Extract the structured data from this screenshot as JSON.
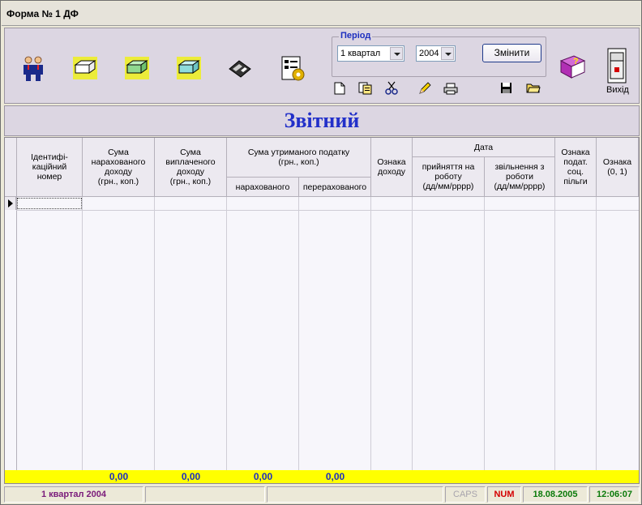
{
  "window": {
    "title": "Форма № 1 ДФ"
  },
  "toolbar": {
    "icons": [
      "people-icon",
      "tray-yellow-icon",
      "tray-green-icon",
      "tray-cyan-icon",
      "floppy-disk-icon",
      "settings-form-icon"
    ],
    "period": {
      "label": "Період",
      "quarter_value": "1 квартал",
      "year_value": "2004",
      "change_label": "Змінити"
    },
    "small_icons": [
      "new-document-icon",
      "copy-document-icon",
      "cut-icon",
      "edit-pencil-icon",
      "print-icon",
      "save-icon",
      "open-folder-icon"
    ],
    "help_icon": "help-book-icon",
    "exit_label": "Вихід"
  },
  "report": {
    "title": "Звітний"
  },
  "grid": {
    "headers": {
      "id": "Ідентифі-\nкаційний\nномер",
      "accrued_income": "Сума\nнарахованого\nдоходу\n(грн., коп.)",
      "paid_income": "Сума\nвиплаченого\nдоходу\n(грн., коп.)",
      "tax_withheld": "Сума утриманого податку\n(грн., коп.)",
      "tax_accrued": "нарахованого",
      "tax_transferred": "перерахованого",
      "income_sign": "Ознака\nдоходу",
      "date": "Дата",
      "hire_date": "прийняття на\nроботу\n(дд/мм/рррр)",
      "dismiss_date": "звільнення з\nроботи\n(дд/мм/рррр)",
      "tax_benefit": "Ознака\nподат.\nсоц.\nпільги",
      "sign01": "Ознака\n(0, 1)"
    },
    "totals": {
      "accrued_income": "0,00",
      "paid_income": "0,00",
      "tax_accrued": "0,00",
      "tax_transferred": "0,00"
    }
  },
  "statusbar": {
    "period": "1 квартал 2004",
    "caps": "CAPS",
    "num": "NUM",
    "date": "18.08.2005",
    "time": "12:06:07"
  },
  "colors": {
    "accent_blue": "#2230c9",
    "totals_bg": "#ffff00",
    "status_purple": "#7a1a7a",
    "status_red": "#d40000",
    "status_green": "#0a7a0a"
  }
}
